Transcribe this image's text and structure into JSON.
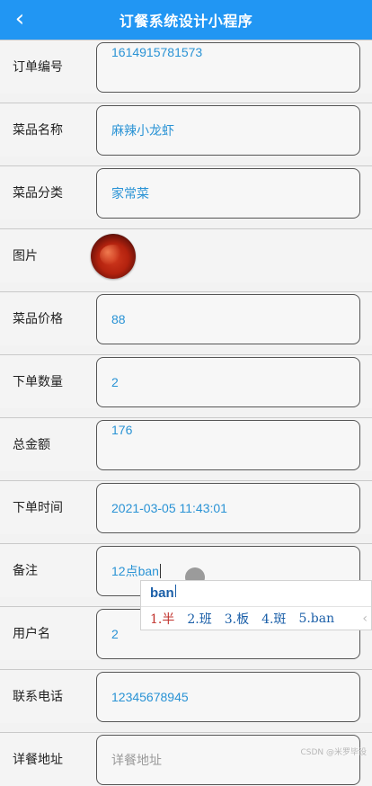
{
  "header": {
    "back_icon": "chevron-left-icon",
    "title": "订餐系统设计小程序",
    "background_color": "#2196f3"
  },
  "fields": [
    {
      "label": "订单编号",
      "value": "1614915781573"
    },
    {
      "label": "菜品名称",
      "value": "麻辣小龙虾"
    },
    {
      "label": "菜品分类",
      "value": "家常菜"
    },
    {
      "label": "图片"
    },
    {
      "label": "菜品价格",
      "value": "88"
    },
    {
      "label": "下单数量",
      "value": "2"
    },
    {
      "label": "总金额",
      "value": "176"
    },
    {
      "label": "下单时间",
      "value": "2021-03-05 11:43:01"
    },
    {
      "label": "备注",
      "value": "12点ban"
    },
    {
      "label": "用户名",
      "value": "2"
    },
    {
      "label": "联系电话",
      "value": "12345678945"
    },
    {
      "label": "详餐地址",
      "placeholder": "详餐地址"
    }
  ],
  "ime": {
    "composition": "ban",
    "candidates": [
      "1.半",
      "2.班",
      "3.板",
      "4.斑",
      "5.ban"
    ],
    "more_icon": "chevron-left-icon"
  },
  "watermark": "CSDN @米罗毕设",
  "value_color": "#2a93d5"
}
